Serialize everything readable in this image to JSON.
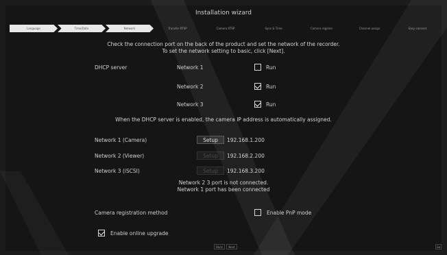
{
  "title": "Installation wizard",
  "steps": [
    "Language",
    "Time/Date",
    "Network",
    "Transfer RTSP",
    "Camera RTSP",
    "Sync & Time",
    "Camera register",
    "Channel assign",
    "Easy connect"
  ],
  "message": {
    "line1": "Check the connection port on the back of the product and set the network of the recorder.",
    "line2": "To set the network setting to basic, click [Next]."
  },
  "dhcp": {
    "label": "DHCP server",
    "rows": [
      {
        "network": "Network 1",
        "run_label": "Run",
        "checked": false
      },
      {
        "network": "Network 2",
        "run_label": "Run",
        "checked": true
      },
      {
        "network": "Network 3",
        "run_label": "Run",
        "checked": true
      }
    ],
    "note": "When the DHCP server is enabled, the camera IP address is automatically assigned."
  },
  "networks": [
    {
      "label": "Network 1 (Camera)",
      "button": "Setup",
      "enabled": true,
      "ip": "192.168.1.200"
    },
    {
      "label": "Network 2 (Viewer)",
      "button": "Setup",
      "enabled": false,
      "ip": "192.168.2.200"
    },
    {
      "label": "Network 3 (iSCSI)",
      "button": "Setup",
      "enabled": false,
      "ip": "192.168.3.200"
    }
  ],
  "status": {
    "line1": "Network 2 3  port is not connected.",
    "line2": "Network 1  port has been connected"
  },
  "registration": {
    "label": "Camera registration method",
    "pnp_label": "Enable PnP mode",
    "pnp_checked": false
  },
  "upgrade": {
    "label": "Enable online upgrade",
    "checked": true
  },
  "nav": {
    "back": "Back",
    "next": "Next",
    "right": "Go"
  },
  "colors": {
    "background": "#151515",
    "text": "#d8d8d8",
    "step_active": "#e8e8e8"
  }
}
